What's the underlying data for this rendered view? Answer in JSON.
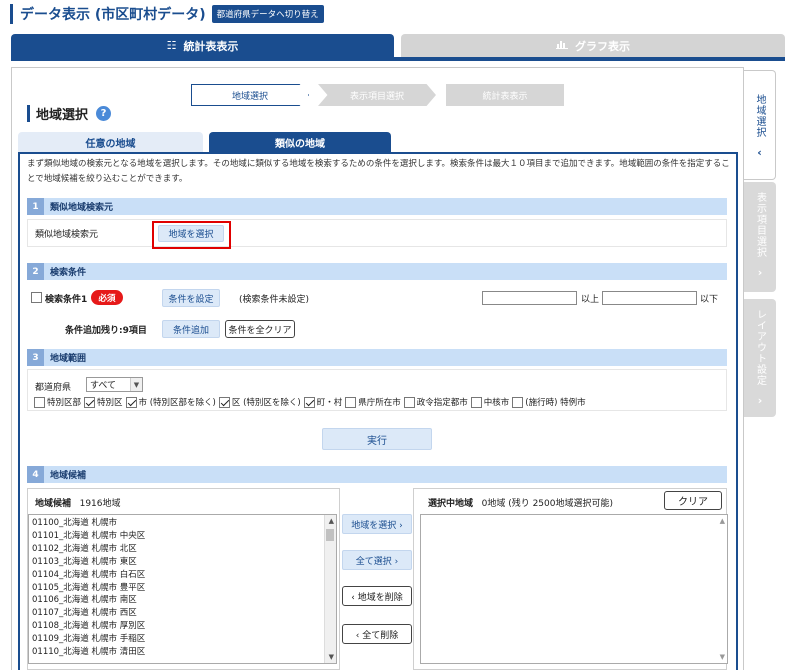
{
  "header": {
    "title": "データ表示 (市区町村データ)",
    "switch_button": "都道府県データへ切り替え"
  },
  "main_tabs": {
    "table": {
      "label": "統計表表示",
      "icon": "table-list-icon"
    },
    "graph": {
      "label": "グラフ表示",
      "icon": "bar-chart-icon"
    }
  },
  "steps": [
    "地域選択",
    "表示項目選択",
    "統計表表示"
  ],
  "area_select": {
    "heading": "地域選択",
    "help": "?",
    "subtabs": [
      "任意の地域",
      "類似の地域"
    ],
    "description": "まず類似地域の検索元となる地域を選択します。その地域に類似する地域を検索するための条件を選択します。検索条件は最大１０項目まで追加できます。地域範囲の条件を指定することで地域候補を絞り込むことができます。"
  },
  "section1": {
    "num": "1",
    "title": "類似地域検索元",
    "label": "類似地域検索元",
    "button": "地域を選択"
  },
  "section2": {
    "num": "2",
    "title": "検索条件",
    "cond_label": "検索条件1",
    "required": "必須",
    "set_button": "条件を設定",
    "status": "(検索条件未設定)",
    "from_value": "",
    "from_suffix": "以上",
    "to_value": "",
    "to_suffix": "以下",
    "remaining": "条件追加残り:9項目",
    "add_button": "条件追加",
    "clear_button": "条件を全クリア"
  },
  "section3": {
    "num": "3",
    "title": "地域範囲",
    "pref_label": "都道府県",
    "pref_value": "すべて",
    "types": [
      {
        "label": "特別区部",
        "checked": false
      },
      {
        "label": "特別区",
        "checked": true
      },
      {
        "label": "市 (特別区部を除く)",
        "checked": true
      },
      {
        "label": "区 (特別区を除く)",
        "checked": true
      },
      {
        "label": "町・村",
        "checked": true
      },
      {
        "label": "県庁所在市",
        "checked": false
      },
      {
        "label": "政令指定都市",
        "checked": false
      },
      {
        "label": "中核市",
        "checked": false
      },
      {
        "label": "(施行時) 特例市",
        "checked": false
      }
    ]
  },
  "run_button": "実行",
  "section4": {
    "num": "4",
    "title": "地域候補",
    "candidates_title": "地域候補",
    "candidates_count": "1916地域",
    "candidates": [
      "01100_北海道 札幌市",
      "01101_北海道 札幌市 中央区",
      "01102_北海道 札幌市 北区",
      "01103_北海道 札幌市 東区",
      "01104_北海道 札幌市 白石区",
      "01105_北海道 札幌市 豊平区",
      "01106_北海道 札幌市 南区",
      "01107_北海道 札幌市 西区",
      "01108_北海道 札幌市 厚別区",
      "01109_北海道 札幌市 手稲区",
      "01110_北海道 札幌市 清田区"
    ],
    "buttons": {
      "select_area": "地域を選択 ›",
      "select_all": "全て選択 ›",
      "remove_area": "‹ 地域を削除",
      "remove_all": "‹ 全て削除"
    },
    "selected_title": "選択中地域",
    "selected_info": "0地域 (残り 2500地域選択可能)",
    "clear_button": "クリア"
  },
  "side_tabs": {
    "area": "地域選択",
    "items": "表示項目選択",
    "layout": "レイアウト設定"
  },
  "colors": {
    "primary": "#1a4d8f",
    "section_bg": "#c9dff7",
    "button_bg": "#dce9f8",
    "required": "#e61919",
    "highlight": "#e00000",
    "inactive": "#d4d4d4"
  }
}
